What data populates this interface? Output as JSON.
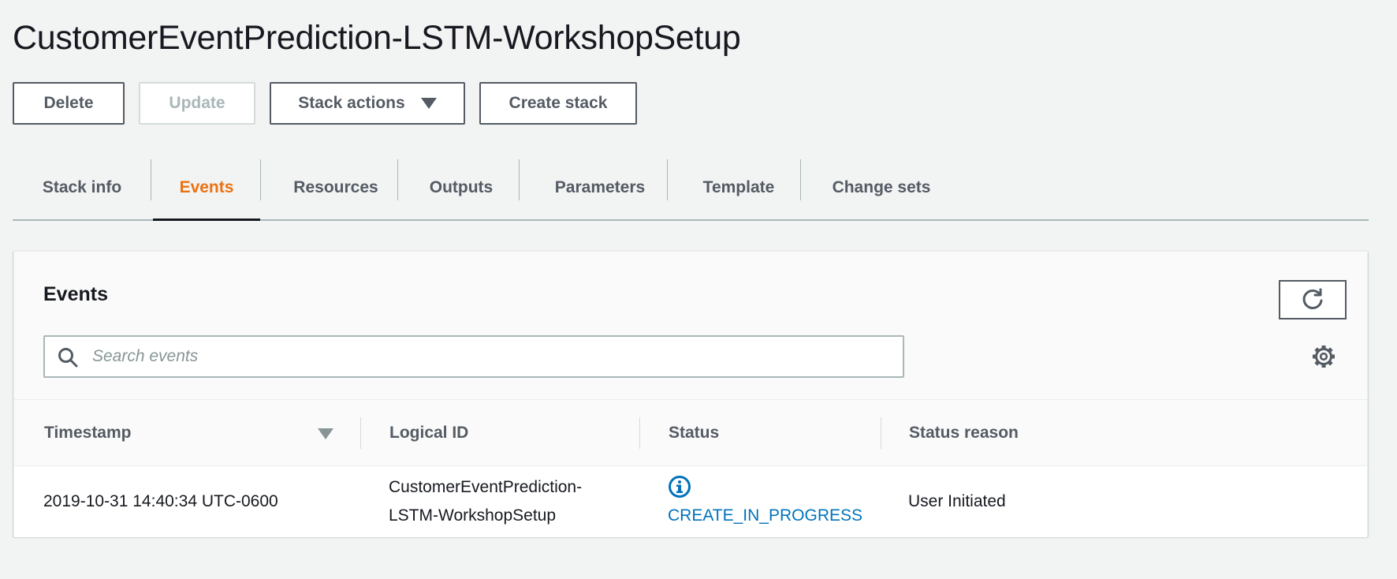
{
  "page": {
    "title": "CustomerEventPrediction-LSTM-WorkshopSetup"
  },
  "toolbar": {
    "delete_label": "Delete",
    "update_label": "Update",
    "stack_actions_label": "Stack actions",
    "create_stack_label": "Create stack"
  },
  "tabs": [
    {
      "label": "Stack info"
    },
    {
      "label": "Events",
      "active": true
    },
    {
      "label": "Resources"
    },
    {
      "label": "Outputs"
    },
    {
      "label": "Parameters"
    },
    {
      "label": "Template"
    },
    {
      "label": "Change sets"
    }
  ],
  "events": {
    "title": "Events",
    "search_placeholder": "Search events",
    "columns": [
      "Timestamp",
      "Logical ID",
      "Status",
      "Status reason"
    ],
    "rows": [
      {
        "timestamp": "2019-10-31 14:40:34 UTC-0600",
        "logical_id_line1": "CustomerEventPrediction-",
        "logical_id_line2": "LSTM-WorkshopSetup",
        "status": "CREATE_IN_PROGRESS",
        "status_icon": "info-icon",
        "status_reason": "User Initiated"
      }
    ]
  },
  "colors": {
    "active_tab": "#ec7211",
    "link": "#0073bb",
    "background": "#f2f3f3"
  }
}
